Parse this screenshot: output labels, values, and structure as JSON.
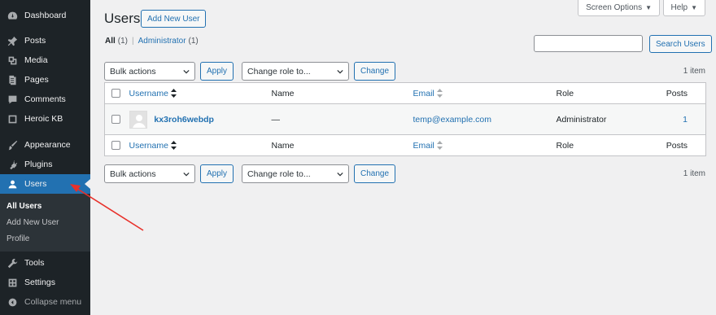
{
  "sidebar": {
    "items": [
      {
        "label": "Dashboard",
        "icon": "dashboard-icon"
      },
      {
        "label": "Posts",
        "icon": "pin-icon"
      },
      {
        "label": "Media",
        "icon": "media-icon"
      },
      {
        "label": "Pages",
        "icon": "pages-icon"
      },
      {
        "label": "Comments",
        "icon": "comments-icon"
      },
      {
        "label": "Heroic KB",
        "icon": "kb-icon"
      },
      {
        "label": "Appearance",
        "icon": "paintbrush-icon"
      },
      {
        "label": "Plugins",
        "icon": "plugins-icon"
      },
      {
        "label": "Users",
        "icon": "users-icon"
      }
    ],
    "submenu": [
      {
        "label": "All Users"
      },
      {
        "label": "Add New User"
      },
      {
        "label": "Profile"
      }
    ],
    "bottom_items": [
      {
        "label": "Tools",
        "icon": "wrench-icon"
      },
      {
        "label": "Settings",
        "icon": "settings-icon"
      },
      {
        "label": "Collapse menu",
        "icon": "collapse-icon"
      }
    ]
  },
  "header": {
    "title": "Users",
    "add_new": "Add New User",
    "screen_options": "Screen Options",
    "help": "Help"
  },
  "filters": {
    "all_label": "All",
    "all_count": "(1)",
    "separator": "|",
    "admin_label": "Administrator",
    "admin_count": "(1)"
  },
  "search": {
    "placeholder": "",
    "button": "Search Users"
  },
  "tablenav_top": {
    "bulk_actions": "Bulk actions",
    "apply": "Apply",
    "change_role": "Change role to...",
    "change": "Change",
    "item_count": "1 item"
  },
  "tablenav_bottom": {
    "bulk_actions": "Bulk actions",
    "apply": "Apply",
    "change_role": "Change role to...",
    "change": "Change",
    "item_count": "1 item"
  },
  "table": {
    "columns": [
      "Username",
      "Name",
      "Email",
      "Role",
      "Posts"
    ],
    "rows": [
      {
        "username": "kx3roh6webdp",
        "name": "—",
        "email": "temp@example.com",
        "role": "Administrator",
        "posts": "1"
      }
    ]
  },
  "colors": {
    "sidebar_bg": "#1d2327",
    "accent": "#2271b1",
    "annotation": "#e8302a"
  }
}
